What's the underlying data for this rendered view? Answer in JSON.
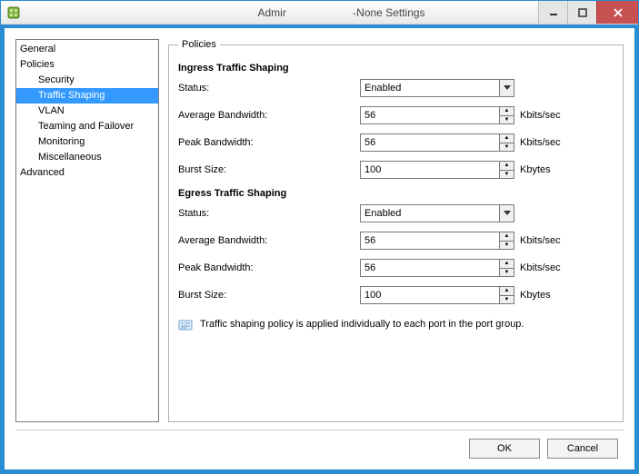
{
  "window": {
    "title_left": "Admir",
    "title_right": "-None Settings"
  },
  "sidebar": {
    "items": [
      {
        "label": "General",
        "level": 1,
        "selected": false
      },
      {
        "label": "Policies",
        "level": 1,
        "selected": false
      },
      {
        "label": "Security",
        "level": 2,
        "selected": false
      },
      {
        "label": "Traffic Shaping",
        "level": 2,
        "selected": true
      },
      {
        "label": "VLAN",
        "level": 2,
        "selected": false
      },
      {
        "label": "Teaming and Failover",
        "level": 2,
        "selected": false
      },
      {
        "label": "Monitoring",
        "level": 2,
        "selected": false
      },
      {
        "label": "Miscellaneous",
        "level": 2,
        "selected": false
      },
      {
        "label": "Advanced",
        "level": 1,
        "selected": false
      }
    ]
  },
  "panel": {
    "group_title": "Policies",
    "ingress": {
      "title": "Ingress Traffic Shaping",
      "status_label": "Status:",
      "status_value": "Enabled",
      "avg_label": "Average Bandwidth:",
      "avg_value": "56",
      "avg_unit": "Kbits/sec",
      "peak_label": "Peak Bandwidth:",
      "peak_value": "56",
      "peak_unit": "Kbits/sec",
      "burst_label": "Burst Size:",
      "burst_value": "100",
      "burst_unit": "Kbytes"
    },
    "egress": {
      "title": "Egress Traffic Shaping",
      "status_label": "Status:",
      "status_value": "Enabled",
      "avg_label": "Average Bandwidth:",
      "avg_value": "56",
      "avg_unit": "Kbits/sec",
      "peak_label": "Peak Bandwidth:",
      "peak_value": "56",
      "peak_unit": "Kbits/sec",
      "burst_label": "Burst Size:",
      "burst_value": "100",
      "burst_unit": "Kbytes"
    },
    "info_text": "Traffic shaping policy is applied individually to each port in the port group."
  },
  "footer": {
    "ok_label": "OK",
    "cancel_label": "Cancel"
  }
}
